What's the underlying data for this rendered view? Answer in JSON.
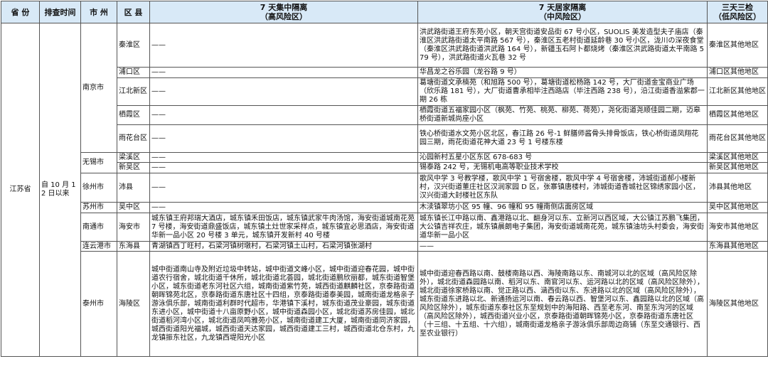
{
  "header": {
    "province": "省 份",
    "time": "排查时间",
    "city": "市 州",
    "district": "区 县",
    "concentrated": "7 天集中隔离",
    "concentrated_sub": "（高风险区）",
    "home": "7 天居家隔离",
    "home_sub": "（中风险区）",
    "test": "三天三检",
    "test_sub": "（低风险区）"
  },
  "province": "江苏省",
  "time": "自 10 月 12 日以来",
  "rows": [
    {
      "city": "南京市",
      "district": "秦淮区",
      "high": "——",
      "mid": "洪武路街道王府东苑小区，朝天宫街道安品街 67 号小区，SUOLIS 美发造型夫子庙店（秦淮区洪武路街道太平南路 567 号），秦淮区五老村街道延龄巷 30 号小区，泷川の深夜食堂（秦淮区洪武路街道洪武路 164 号），新疆玉石阿卜都烧烤（秦淮区洪武路街道太平南路 579 号），洪武路街道火瓦巷 32 号",
      "low": "秦淮区其他地区"
    },
    {
      "district": "浦口区",
      "high": "——",
      "mid": "华昌龙之谷乐园（龙谷路 9 号）",
      "low": "浦口区其他地区"
    },
    {
      "district": "江北新区",
      "high": "——",
      "mid": "葛塘街道文承楠苑（和旭路 500 号），葛塘街道松杨路 142 号，大厂街道金宝商业广场（欣乐路 181 号），大厂街道曹承相毕注西路店（毕注西路 238 号），沿江街道香溢紫郡一期 26 栋",
      "low": "江北新区其他地区"
    },
    {
      "district": "栖霞区",
      "high": "——",
      "mid": "栖霞街道五福家园小区（枫苑、竹苑、桃苑、柳苑、荷苑），尧化街道尧顺佳园二期，迈皋桥街道新城尚座小区",
      "low": "栖霞区其他地区"
    },
    {
      "district": "雨花台区",
      "high": "——",
      "mid": "铁心桥街道水文苑小区北区，春江路 26 号-1 鲜膳师酱骨头排骨饭店，铁心桥街道凤翔花园三期，雨花街道花神大道 23 号 1 号楼东楼",
      "low": "雨花台区其他地区"
    },
    {
      "city": "无锡市",
      "district": "梁溪区",
      "high": "——",
      "mid": "沁园新村五星小区东区 678-683 号",
      "low": "梁溪区其他地区"
    },
    {
      "district": "新吴区",
      "high": "——",
      "mid": "锡泰路 242 号，无锡机电高等职业技术学校",
      "low": "新吴区其他地区"
    },
    {
      "city": "徐州市",
      "district": "沛县",
      "high": "——",
      "mid": "歌风中学 3 号教学楼，歌风中学 1 号宿舍楼，歌风中学 4 号宿舍楼，沛城街道郝小楼新村，汉兴街道董庄社区汉润家园 D 区，张寨镇唐楼村，沛城街道香城社区锦绣家园小区，汉兴街道大封楼社区东队",
      "low": "沛县其他地区"
    },
    {
      "city": "苏州市",
      "district": "吴中区",
      "high": "——",
      "mid": "木渎镇翠坊小区 95 幢、96 幢和 95 幢南侧店面房区域",
      "low": "吴中区其他地区"
    },
    {
      "city": "南通市",
      "district": "海安市",
      "high": "城东镇王府邦瑞大酒店，城东镇禾田饭店，城东镇武家牛肉汤馆，海安街道城南花苑 7 号楼，海安街道鼎盛饭店，城东镇土灶世家采样点，城东镇宜必思酒店，海安街道华新一品小区 20 号楼 3 单元，城东镇开发新村 40 号楼",
      "mid": "城东镇长江中路以南、鑫港路以北、翻身河以东、立新河以西区域，大公镇江苏鹏飞集团，大公镇吉祥农庄，城东镇晨朗电子集团，海安街道城南花苑，城东镇油坊头村委会，海安街道华新一品小区",
      "low": "海安市其他地区"
    },
    {
      "city": "连云港市",
      "district": "东海县",
      "high": "青湖镇西丁旺村，石梁河镇树墩村，石梁河镇土山村，石梁河镇张湖村",
      "mid": "——",
      "low": "东海县其他地区"
    },
    {
      "city": "泰州市",
      "district": "海陵区",
      "high": "城中街道南山寺及附近垃圾中转站，城中街道文峰小区，城中街道迎春花园，城中街道农行宿舍，城北街道千休所，城北街道北荟园，城北街道鹏欣丽都，城东街道智堡小区，城东街道老东河社区六组，城南街道紫竹苑，城西街道麒麟社区，京泰路街道朝晖锦苑北区，京泰路街道东唐社区十四组，京泰路街道泰美园，城南街道龙格亲子游泳俱乐部，城南街道利群时代超市，华港镇下溪村，城东街道茂业豪园，城东街道东进小区，城中街道十八亩原野小区，城中街道森园小区，城北街道苏房佳园，城北街道稻河湾小区，城北街道凤鸣雅苑小区，城南街道建工大厦，城南街道同济家园，城西街道阳光福城，城西街道天达家园，城西街道建工三村，城西街道北仓东村，九龙镇振东社区，九龙镇西堤阳光小区",
      "mid": "城中街道迎春西路以南、鼓楼南路以西、海陵南路以东、南城河以北的区域（高风险区除外），城北街道森园路以南、稻河以东、南官河以东、运河路以北的区域（高风险区除外），城北街道徐家桥路以南、觉正路以西、涵西街以东、东进路以北的区域（高风险区除外），城东街道东进路以北、新通扬运河以南、春云路以西、智堡河以东、鑫园路以北的区域（高风险区除外），城东街道东泰社区东至规划中的海阳路、西至老东河、南至东沟河的区域（高风险区除外），城西街道兴业小区，京泰路街道朝晖锦苑小区，京泰路街道东唐社区（十三组、十五组、十六组），城南街道龙格亲子游泳俱乐部周边商铺（东至交通银行、西至农业银行）",
      "low": "海陵区其他地区"
    }
  ]
}
